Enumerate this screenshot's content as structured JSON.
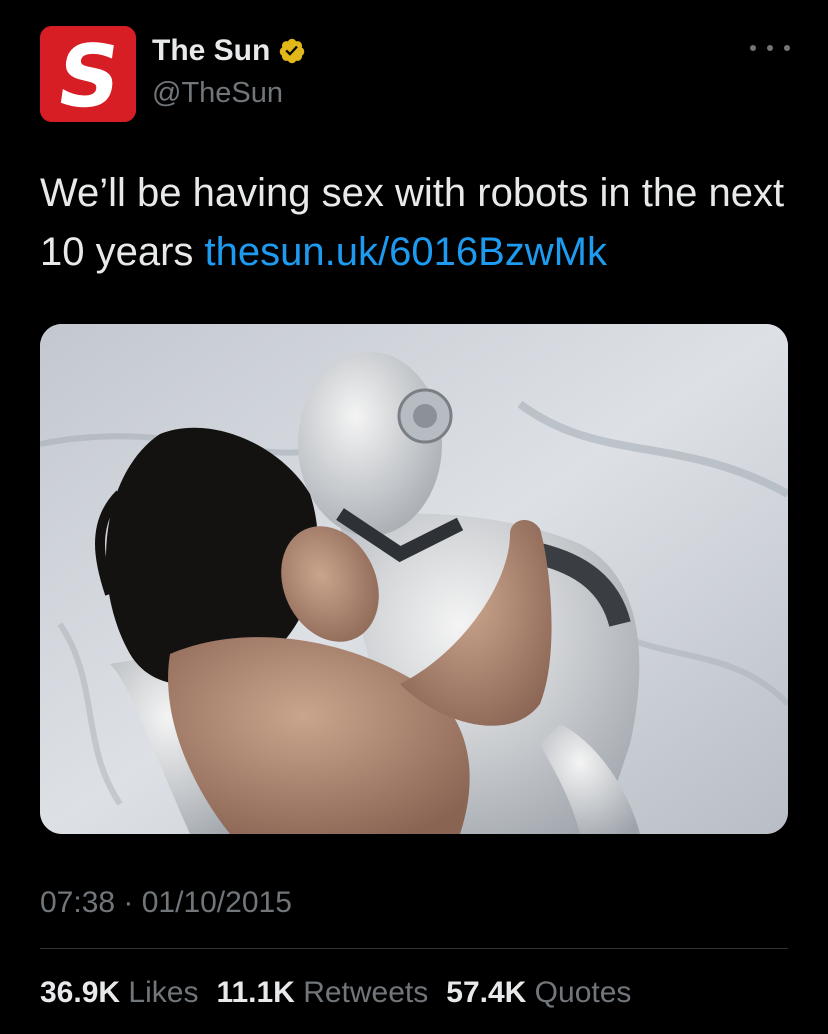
{
  "tweet": {
    "author": {
      "display_name": "The Sun",
      "handle": "@TheSun",
      "avatar_icon": "the-sun-logo",
      "verified_icon": "verified-badge-icon",
      "verified_color": "#e2b719",
      "avatar_color": "#d71e25"
    },
    "more_icon": "more-options-icon",
    "text": {
      "body": "We’ll be having sex with robots in the next 10 years ",
      "link": "thesun.uk/6016BzwMk"
    },
    "timestamp": "07:38 · 01/10/2015",
    "stats": {
      "likes": {
        "count": "36.9K",
        "label": "Likes"
      },
      "retweets": {
        "count": "11.1K",
        "label": "Retweets"
      },
      "quotes": {
        "count": "57.4K",
        "label": "Quotes"
      }
    }
  },
  "colors": {
    "background": "#000000",
    "text": "#e7e9ea",
    "secondary_text": "#71767b",
    "link": "#1d9bf0",
    "divider": "#2f3336"
  }
}
